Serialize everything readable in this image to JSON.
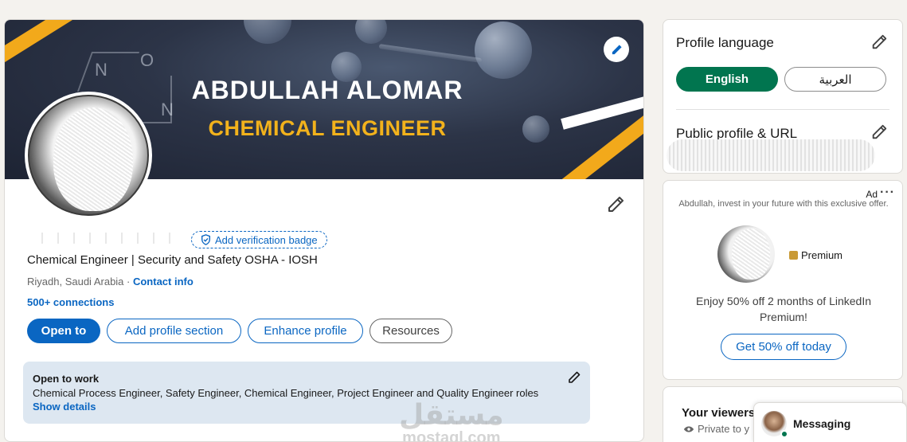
{
  "banner": {
    "name": "ABDULLAH ALOMAR",
    "title": "CHEMICAL ENGINEER",
    "chem_letters": [
      "N",
      "O",
      "N"
    ]
  },
  "profile": {
    "verification_badge": "Add verification badge",
    "headline": "Chemical Engineer | Security and Safety OSHA - IOSH",
    "location": "Riyadh, Saudi Arabia · ",
    "contact_info": "Contact info",
    "connections": "500+ connections"
  },
  "actions": {
    "open_to": "Open to",
    "add_section": "Add profile section",
    "enhance": "Enhance profile",
    "resources": "Resources"
  },
  "open_to_work": {
    "title": "Open to work",
    "roles": "Chemical Process Engineer, Safety Engineer, Chemical Engineer, Project Engineer and Quality Engineer roles",
    "show_details": "Show details"
  },
  "watermark": {
    "arabic": "مستقل",
    "latin": "mostaql.com"
  },
  "sidebar": {
    "language_title": "Profile language",
    "language_english": "English",
    "language_arabic": "العربية",
    "public_profile_title": "Public profile & URL"
  },
  "ad": {
    "label": "Ad",
    "more": "···",
    "text": "Abdullah, invest in your future with this exclusive offer.",
    "premium": "Premium",
    "offer": "Enjoy 50% off 2 months of LinkedIn Premium!",
    "cta": "Get 50% off today"
  },
  "viewers": {
    "title": "Your viewers",
    "subtitle": "Private to y"
  },
  "messaging": {
    "label": "Messaging"
  },
  "colors": {
    "brand_blue": "#0a66c2",
    "language_active_green": "#01754f",
    "banner_accent": "#f2b21c",
    "open_to_work_bg": "#dde7f1"
  }
}
